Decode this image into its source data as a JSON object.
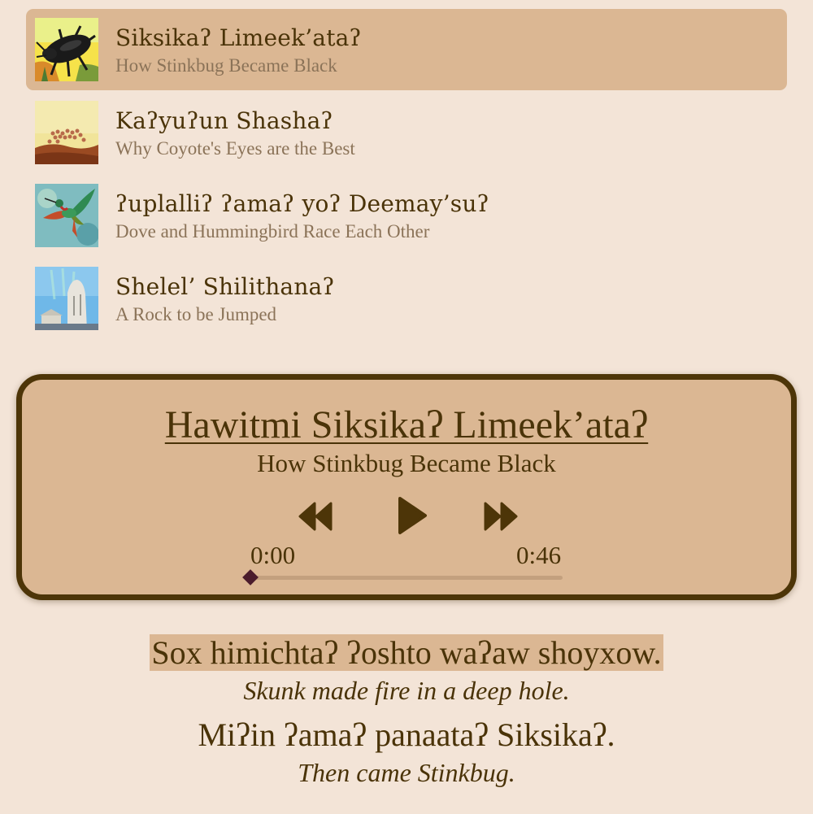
{
  "stories": [
    {
      "title": "Siksikaʔ Limeek’ataʔ",
      "subtitle": "How Stinkbug Became Black",
      "selected": true,
      "icon": "stinkbug-image"
    },
    {
      "title": "Kaʔyuʔun Shashaʔ",
      "subtitle": "Why Coyote's Eyes are the Best",
      "selected": false,
      "icon": "coyote-eyes-image"
    },
    {
      "title": "ʔuplalliʔ ʔamaʔ yoʔ Deemay’suʔ",
      "subtitle": "Dove and Hummingbird Race Each Other",
      "selected": false,
      "icon": "hummingbird-image"
    },
    {
      "title": "Shelel’ Shilithanaʔ",
      "subtitle": "A Rock to be Jumped",
      "selected": false,
      "icon": "rock-image"
    }
  ],
  "player": {
    "title": "Hawitmi Siksikaʔ Limeek’ataʔ",
    "subtitle": "How Stinkbug Became Black",
    "current_time": "0:00",
    "total_time": "0:46",
    "progress_fraction": 0.0
  },
  "transcript": [
    {
      "native": "Sox himichtaʔ ʔoshto waʔaw shoyxow.",
      "english": "Skunk made fire in a deep hole.",
      "active": true
    },
    {
      "native": "Miʔin ʔamaʔ panaataʔ Siksikaʔ.",
      "english": "Then came Stinkbug.",
      "active": false
    }
  ],
  "colors": {
    "background": "#f3e4d7",
    "accent": "#dbb793",
    "text": "#4a3308",
    "subtext": "#8b7358",
    "player_border": "#4d3508",
    "progress_thumb": "#4b1c2c"
  }
}
